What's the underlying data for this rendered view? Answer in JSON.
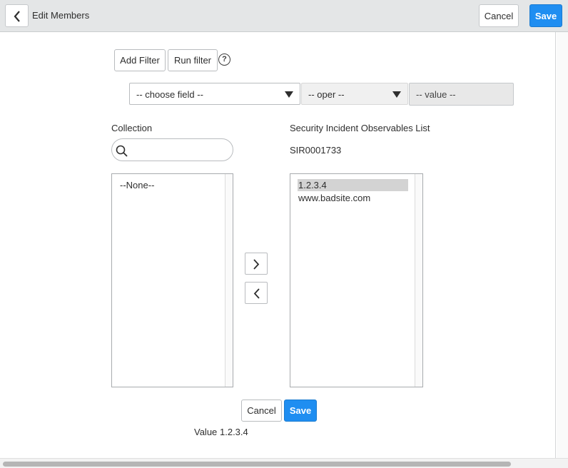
{
  "header": {
    "title": "Edit Members",
    "cancel_label": "Cancel",
    "save_label": "Save"
  },
  "filter": {
    "add_filter_label": "Add Filter",
    "run_filter_label": "Run filter",
    "help_icon": "?",
    "field_select": "-- choose field --",
    "oper_select": "-- oper --",
    "value_field": "-- value --"
  },
  "collection": {
    "label": "Collection",
    "search_placeholder": "",
    "items": [
      "--None--"
    ]
  },
  "selected": {
    "label": "Security Incident Observables List",
    "record": "SIR0001733",
    "items": [
      "1.2.3.4",
      "www.badsite.com"
    ]
  },
  "footer": {
    "cancel_label": "Cancel",
    "save_label": "Save",
    "value_label": "Value",
    "value_text": "1.2.3.4"
  },
  "colors": {
    "primary": "#1f8ef1",
    "header_bg": "#e4e6e7",
    "selected_item_bg": "#d3d3d3"
  },
  "icons": {
    "back": "chevron-left-icon",
    "move_right": "chevron-right-icon",
    "move_left": "chevron-left-icon",
    "search": "search-icon",
    "dropdown": "caret-down-icon"
  }
}
